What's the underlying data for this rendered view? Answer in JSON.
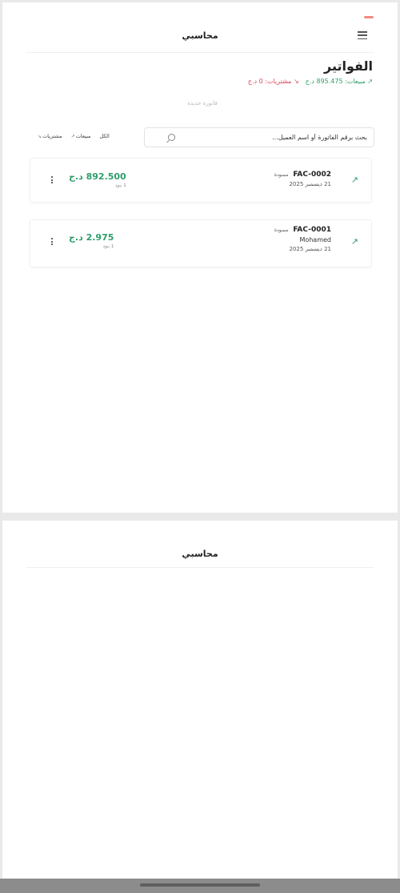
{
  "app": {
    "title": "محاسبي"
  },
  "invoices_section": {
    "title": "الفواتير",
    "sales_summary": "مبيعات: 895.475 د.ج",
    "purchases_summary": "مشتريات: 0 د.ج",
    "new_invoice_label": "فاتورة جديدة"
  },
  "search": {
    "placeholder": "بحث برقم الفاتورة أو اسم العميل..."
  },
  "filters": {
    "purchases": "مشتريات",
    "sales": "مبيعات",
    "all": "الكل"
  },
  "invoices": [
    {
      "number": "FAC-0002",
      "status": "مسودة",
      "client": "",
      "date": "21 ديسمبر 2025",
      "amount": "892.500 د.ج",
      "items": "1 بنود"
    },
    {
      "number": "FAC-0001",
      "status": "مسودة",
      "client": "Mohamed",
      "date": "21 ديسمبر 2025",
      "amount": "2.975 د.ج",
      "items": "1 بنود"
    }
  ],
  "colors": {
    "accent_green": "#2e9e6a",
    "accent_red": "#d8485a"
  },
  "icons": {
    "menu": "hamburger-menu-icon",
    "search": "search-icon",
    "trend": "trending-up-icon",
    "more": "more-vertical-icon"
  }
}
